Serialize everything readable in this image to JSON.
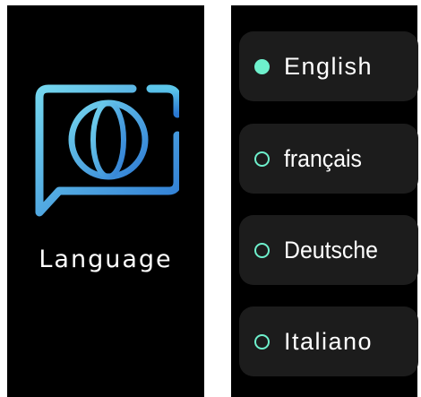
{
  "left_panel": {
    "icon": "language-globe-chat-icon",
    "title": "Language",
    "accent_gradient": [
      "#6cd3ea",
      "#2f7fd6"
    ]
  },
  "language_options": [
    {
      "label": "English",
      "selected": true
    },
    {
      "label": "français",
      "selected": false
    },
    {
      "label": "Deutsche",
      "selected": false
    },
    {
      "label": "Italiano",
      "selected": false
    }
  ],
  "colors": {
    "background": "#000000",
    "card": "#1c1c1c",
    "radio_accent": "#6ef0cc",
    "text": "#ffffff"
  }
}
